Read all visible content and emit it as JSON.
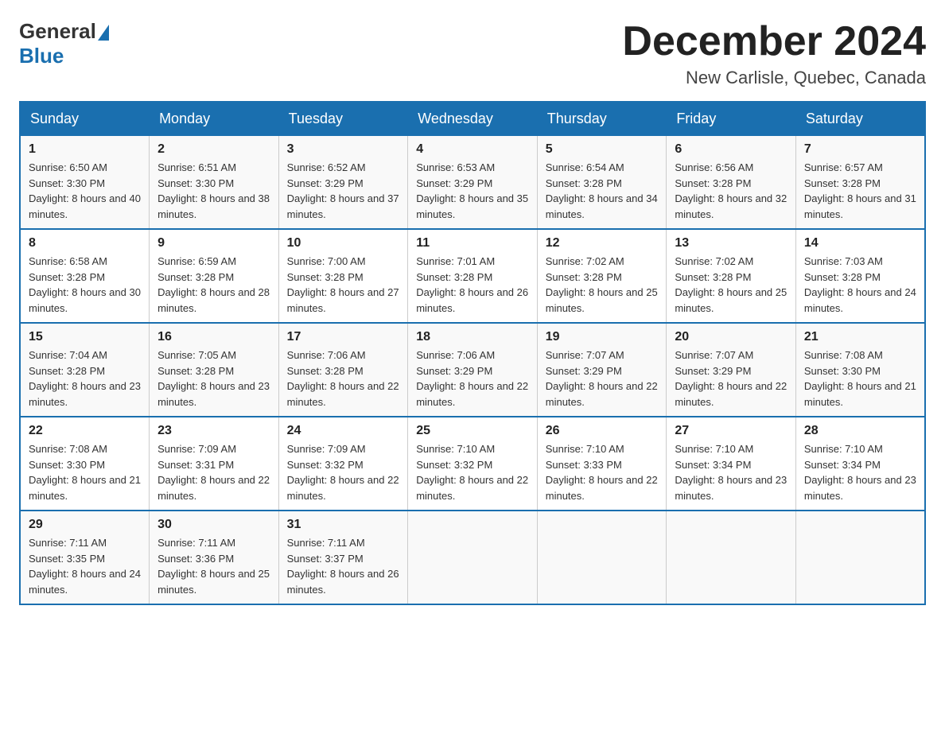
{
  "logo": {
    "general": "General",
    "blue": "Blue"
  },
  "title": "December 2024",
  "location": "New Carlisle, Quebec, Canada",
  "days_of_week": [
    "Sunday",
    "Monday",
    "Tuesday",
    "Wednesday",
    "Thursday",
    "Friday",
    "Saturday"
  ],
  "weeks": [
    [
      {
        "day": "1",
        "sunrise": "Sunrise: 6:50 AM",
        "sunset": "Sunset: 3:30 PM",
        "daylight": "Daylight: 8 hours and 40 minutes."
      },
      {
        "day": "2",
        "sunrise": "Sunrise: 6:51 AM",
        "sunset": "Sunset: 3:30 PM",
        "daylight": "Daylight: 8 hours and 38 minutes."
      },
      {
        "day": "3",
        "sunrise": "Sunrise: 6:52 AM",
        "sunset": "Sunset: 3:29 PM",
        "daylight": "Daylight: 8 hours and 37 minutes."
      },
      {
        "day": "4",
        "sunrise": "Sunrise: 6:53 AM",
        "sunset": "Sunset: 3:29 PM",
        "daylight": "Daylight: 8 hours and 35 minutes."
      },
      {
        "day": "5",
        "sunrise": "Sunrise: 6:54 AM",
        "sunset": "Sunset: 3:28 PM",
        "daylight": "Daylight: 8 hours and 34 minutes."
      },
      {
        "day": "6",
        "sunrise": "Sunrise: 6:56 AM",
        "sunset": "Sunset: 3:28 PM",
        "daylight": "Daylight: 8 hours and 32 minutes."
      },
      {
        "day": "7",
        "sunrise": "Sunrise: 6:57 AM",
        "sunset": "Sunset: 3:28 PM",
        "daylight": "Daylight: 8 hours and 31 minutes."
      }
    ],
    [
      {
        "day": "8",
        "sunrise": "Sunrise: 6:58 AM",
        "sunset": "Sunset: 3:28 PM",
        "daylight": "Daylight: 8 hours and 30 minutes."
      },
      {
        "day": "9",
        "sunrise": "Sunrise: 6:59 AM",
        "sunset": "Sunset: 3:28 PM",
        "daylight": "Daylight: 8 hours and 28 minutes."
      },
      {
        "day": "10",
        "sunrise": "Sunrise: 7:00 AM",
        "sunset": "Sunset: 3:28 PM",
        "daylight": "Daylight: 8 hours and 27 minutes."
      },
      {
        "day": "11",
        "sunrise": "Sunrise: 7:01 AM",
        "sunset": "Sunset: 3:28 PM",
        "daylight": "Daylight: 8 hours and 26 minutes."
      },
      {
        "day": "12",
        "sunrise": "Sunrise: 7:02 AM",
        "sunset": "Sunset: 3:28 PM",
        "daylight": "Daylight: 8 hours and 25 minutes."
      },
      {
        "day": "13",
        "sunrise": "Sunrise: 7:02 AM",
        "sunset": "Sunset: 3:28 PM",
        "daylight": "Daylight: 8 hours and 25 minutes."
      },
      {
        "day": "14",
        "sunrise": "Sunrise: 7:03 AM",
        "sunset": "Sunset: 3:28 PM",
        "daylight": "Daylight: 8 hours and 24 minutes."
      }
    ],
    [
      {
        "day": "15",
        "sunrise": "Sunrise: 7:04 AM",
        "sunset": "Sunset: 3:28 PM",
        "daylight": "Daylight: 8 hours and 23 minutes."
      },
      {
        "day": "16",
        "sunrise": "Sunrise: 7:05 AM",
        "sunset": "Sunset: 3:28 PM",
        "daylight": "Daylight: 8 hours and 23 minutes."
      },
      {
        "day": "17",
        "sunrise": "Sunrise: 7:06 AM",
        "sunset": "Sunset: 3:28 PM",
        "daylight": "Daylight: 8 hours and 22 minutes."
      },
      {
        "day": "18",
        "sunrise": "Sunrise: 7:06 AM",
        "sunset": "Sunset: 3:29 PM",
        "daylight": "Daylight: 8 hours and 22 minutes."
      },
      {
        "day": "19",
        "sunrise": "Sunrise: 7:07 AM",
        "sunset": "Sunset: 3:29 PM",
        "daylight": "Daylight: 8 hours and 22 minutes."
      },
      {
        "day": "20",
        "sunrise": "Sunrise: 7:07 AM",
        "sunset": "Sunset: 3:29 PM",
        "daylight": "Daylight: 8 hours and 22 minutes."
      },
      {
        "day": "21",
        "sunrise": "Sunrise: 7:08 AM",
        "sunset": "Sunset: 3:30 PM",
        "daylight": "Daylight: 8 hours and 21 minutes."
      }
    ],
    [
      {
        "day": "22",
        "sunrise": "Sunrise: 7:08 AM",
        "sunset": "Sunset: 3:30 PM",
        "daylight": "Daylight: 8 hours and 21 minutes."
      },
      {
        "day": "23",
        "sunrise": "Sunrise: 7:09 AM",
        "sunset": "Sunset: 3:31 PM",
        "daylight": "Daylight: 8 hours and 22 minutes."
      },
      {
        "day": "24",
        "sunrise": "Sunrise: 7:09 AM",
        "sunset": "Sunset: 3:32 PM",
        "daylight": "Daylight: 8 hours and 22 minutes."
      },
      {
        "day": "25",
        "sunrise": "Sunrise: 7:10 AM",
        "sunset": "Sunset: 3:32 PM",
        "daylight": "Daylight: 8 hours and 22 minutes."
      },
      {
        "day": "26",
        "sunrise": "Sunrise: 7:10 AM",
        "sunset": "Sunset: 3:33 PM",
        "daylight": "Daylight: 8 hours and 22 minutes."
      },
      {
        "day": "27",
        "sunrise": "Sunrise: 7:10 AM",
        "sunset": "Sunset: 3:34 PM",
        "daylight": "Daylight: 8 hours and 23 minutes."
      },
      {
        "day": "28",
        "sunrise": "Sunrise: 7:10 AM",
        "sunset": "Sunset: 3:34 PM",
        "daylight": "Daylight: 8 hours and 23 minutes."
      }
    ],
    [
      {
        "day": "29",
        "sunrise": "Sunrise: 7:11 AM",
        "sunset": "Sunset: 3:35 PM",
        "daylight": "Daylight: 8 hours and 24 minutes."
      },
      {
        "day": "30",
        "sunrise": "Sunrise: 7:11 AM",
        "sunset": "Sunset: 3:36 PM",
        "daylight": "Daylight: 8 hours and 25 minutes."
      },
      {
        "day": "31",
        "sunrise": "Sunrise: 7:11 AM",
        "sunset": "Sunset: 3:37 PM",
        "daylight": "Daylight: 8 hours and 26 minutes."
      },
      null,
      null,
      null,
      null
    ]
  ]
}
